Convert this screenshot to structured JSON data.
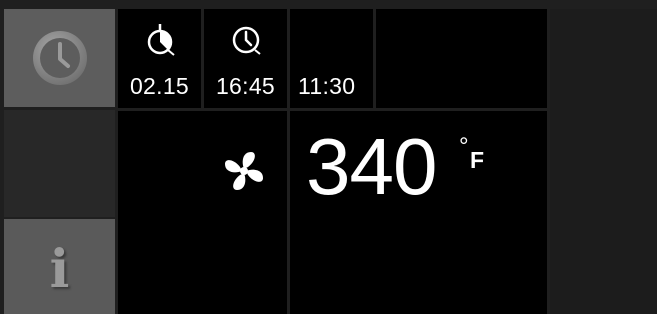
{
  "left_menu": {
    "clock_icon": "clock-icon",
    "info_icon": "info-icon",
    "info_glyph": "i"
  },
  "timers": {
    "cook_timer": {
      "icon": "timer-icon",
      "value": "02.15"
    },
    "end_time": {
      "icon": "end-time-clock-icon",
      "value": "16:45"
    },
    "current_time": {
      "value": "11:30"
    }
  },
  "oven": {
    "fan_icon": "fan-icon",
    "temperature": "340",
    "degree_symbol": "°",
    "unit": "F"
  },
  "colors": {
    "tile_gray": "#5d5d5d",
    "panel_black": "#000000",
    "background": "#1f1f1f",
    "text": "#ffffff"
  }
}
